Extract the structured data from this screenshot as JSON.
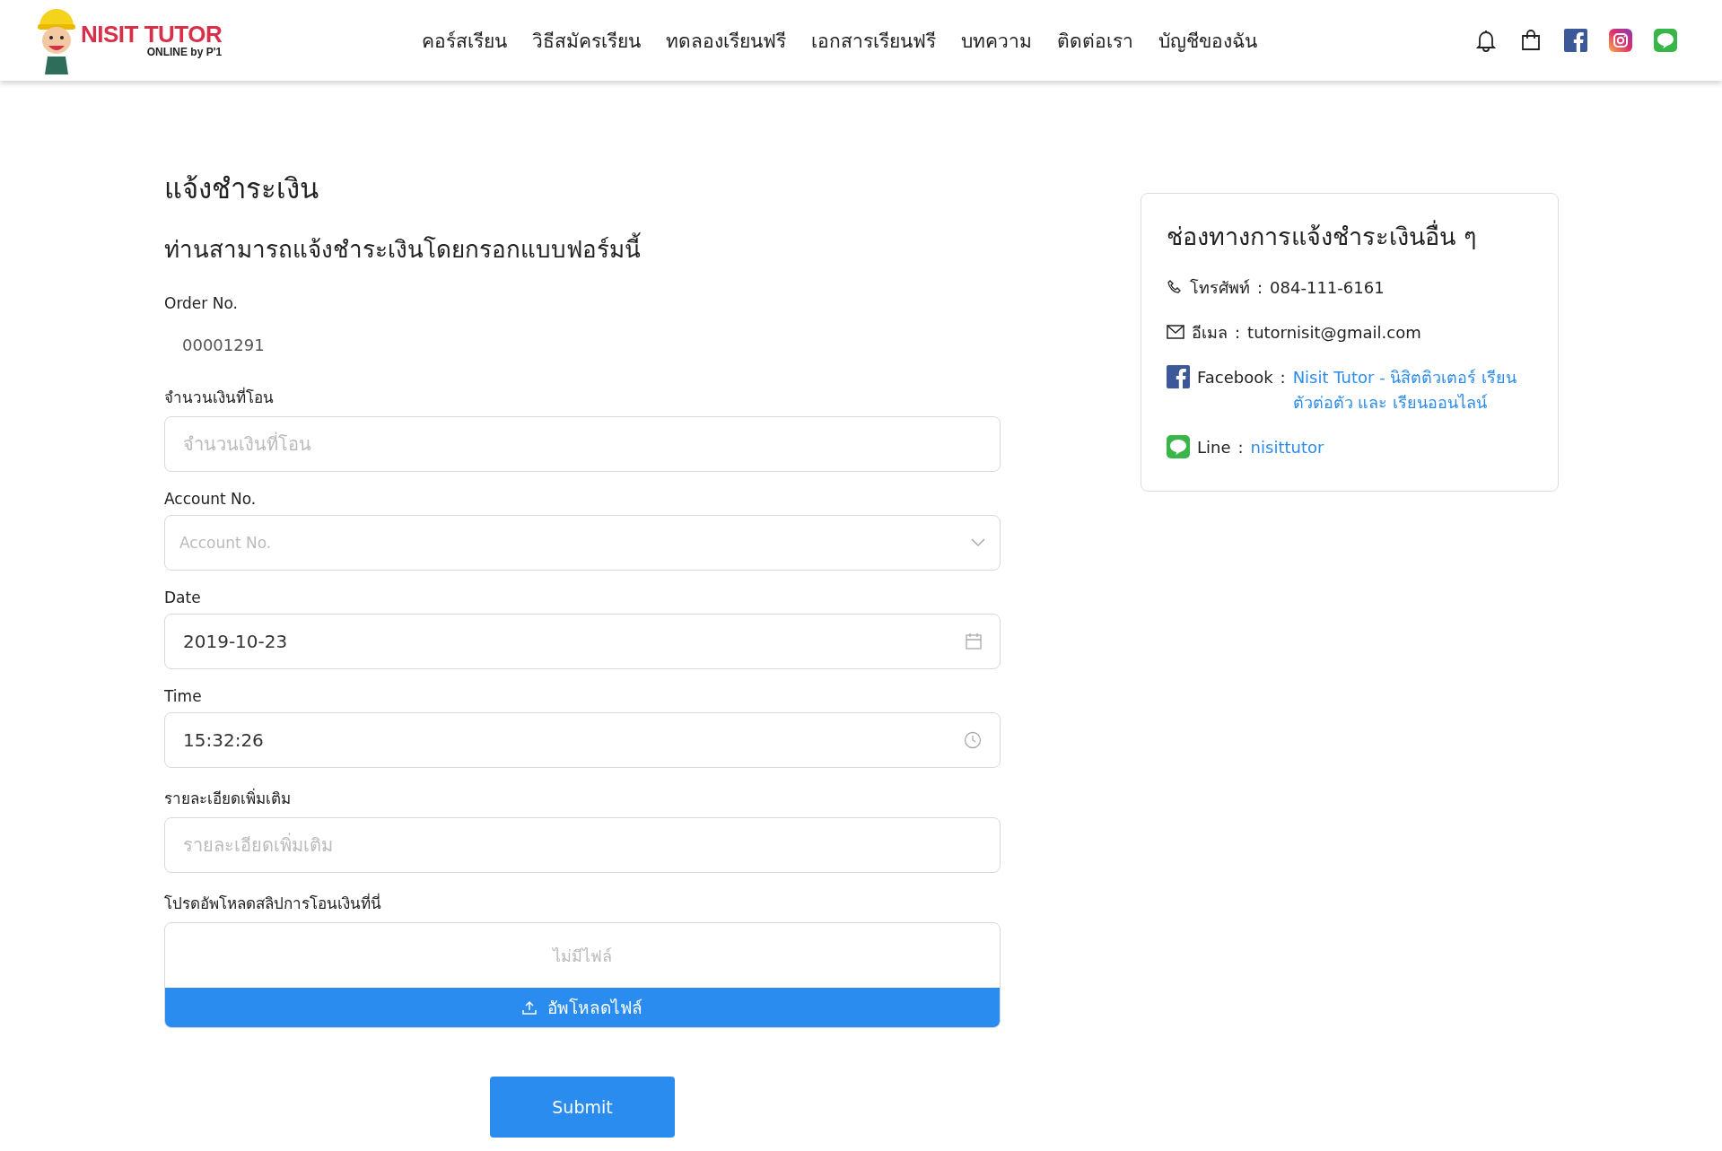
{
  "header": {
    "logo": {
      "title": "NISIT TUTOR",
      "subtitle": "ONLINE by P'1"
    },
    "nav": [
      {
        "label": "คอร์สเรียน"
      },
      {
        "label": "วิธีสมัครเรียน"
      },
      {
        "label": "ทดลองเรียนฟรี"
      },
      {
        "label": "เอกสารเรียนฟรี"
      },
      {
        "label": "บทความ"
      },
      {
        "label": "ติดต่อเรา"
      },
      {
        "label": "บัญชีของฉัน"
      }
    ],
    "icons": [
      {
        "kind": "bell"
      },
      {
        "kind": "bag"
      },
      {
        "kind": "facebook"
      },
      {
        "kind": "instagram"
      },
      {
        "kind": "line"
      }
    ]
  },
  "form": {
    "title": "แจ้งชำระเงิน",
    "subtitle": "ท่านสามารถแจ้งชำระเงินโดยกรอกแบบฟอร์มนี้",
    "fields": [
      {
        "kind": "readonly",
        "label": "Order No.",
        "value": "00001291"
      },
      {
        "kind": "text",
        "label": "จำนวนเงินที่โอน",
        "placeholder": "จำนวนเงินที่โอน"
      },
      {
        "kind": "select",
        "label": "Account No.",
        "placeholder": "Account No."
      },
      {
        "kind": "date",
        "label": "Date",
        "value": "2019-10-23"
      },
      {
        "kind": "time",
        "label": "Time",
        "value": "15:32:26"
      },
      {
        "kind": "text",
        "label": "รายละเอียดเพิ่มเติม",
        "placeholder": "รายละเอียดเพิ่มเติม"
      }
    ],
    "upload": {
      "label": "โปรดอัพโหลดสลิปการโอนเงินที่นี่",
      "status": "ไม่มีไฟล์",
      "button": "อัพโหลดไฟล์"
    },
    "submit": "Submit"
  },
  "contact_card": {
    "title": "ช่องทางการแจ้งชำระเงินอื่น ๆ",
    "items": [
      {
        "kind": "phone",
        "label": "โทรศัพท์",
        "separator": ":",
        "value": "084-111-6161",
        "link": false
      },
      {
        "kind": "email",
        "label": "อีเมล",
        "separator": ":",
        "value": "tutornisit@gmail.com",
        "link": false
      },
      {
        "kind": "facebook",
        "label": "Facebook",
        "separator": ":",
        "value": "Nisit Tutor - นิสิตติวเตอร์ เรียนตัวต่อตัว และ เรียนออนไลน์",
        "link": true
      },
      {
        "kind": "line",
        "label": "Line",
        "separator": ":",
        "value": "nisittutor",
        "link": true
      }
    ]
  }
}
